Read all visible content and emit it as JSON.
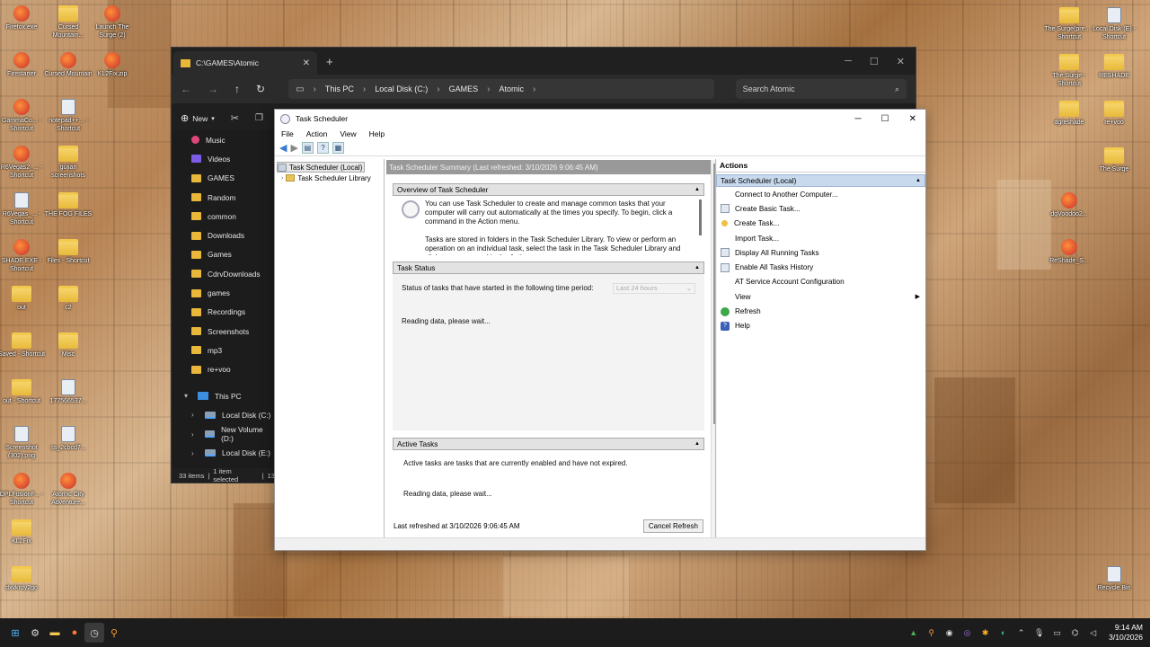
{
  "desktop": {
    "icons_left": [
      {
        "label": "Firefox.exe",
        "type": "app"
      },
      {
        "label": "Cursed Mountain...",
        "type": "folder"
      },
      {
        "label": "Launch The Surge (2)",
        "type": "app"
      },
      {
        "label": "Firestarter",
        "type": "app"
      },
      {
        "label": "Cursed Mountain",
        "type": "app"
      },
      {
        "label": "KL2Fix.zip",
        "type": "app"
      },
      {
        "label": "GammaCo... - Shortcut",
        "type": "app"
      },
      {
        "label": "notepad++... - Shortcut",
        "type": "file"
      },
      {
        "label": "R6Vegas2_... - Shortcut",
        "type": "app"
      },
      {
        "label": "gujian screenshots",
        "type": "folder"
      },
      {
        "label": "R6Vegas_... - Shortcut",
        "type": "file"
      },
      {
        "label": "THE FOG FILES",
        "type": "folder"
      },
      {
        "label": "SHADE.EXE - Shortcut",
        "type": "app"
      },
      {
        "label": "Files - Shortcut",
        "type": "folder"
      },
      {
        "label": "out",
        "type": "folder"
      },
      {
        "label": "c2",
        "type": "folder"
      },
      {
        "label": "Saved - Shortcut",
        "type": "folder"
      },
      {
        "label": "Misc",
        "type": "folder"
      },
      {
        "label": "out - Shortcut",
        "type": "folder"
      },
      {
        "label": "177566537...",
        "type": "file"
      },
      {
        "label": "Screenshot (302).png",
        "type": "file"
      },
      {
        "label": "ss_2cbcd7...",
        "type": "file"
      },
      {
        "label": "DPLFusionF... - Shortcut",
        "type": "app"
      },
      {
        "label": "Atomic City Adventure...",
        "type": "app"
      },
      {
        "label": "KL2Fix",
        "type": "folder"
      },
      {
        "label": "dxvkrdy2go",
        "type": "folder"
      }
    ],
    "icons_right": [
      {
        "label": "The Surge(pre... - Shortcut",
        "type": "folder"
      },
      {
        "label": "Local Disk (E) - Shortcut",
        "type": "file"
      },
      {
        "label": "The Surge - Shortcut",
        "type": "folder"
      },
      {
        "label": "RESHADE",
        "type": "folder"
      },
      {
        "label": "dgreshade",
        "type": "folder"
      },
      {
        "label": "re+voo",
        "type": "folder"
      },
      {
        "label": "The Surge",
        "type": "folder"
      },
      {
        "label": "dgVoodoo2...",
        "type": "app"
      },
      {
        "label": "ReShade_S...",
        "type": "app"
      },
      {
        "label": "Recycle Bin",
        "type": "file"
      }
    ]
  },
  "explorer": {
    "tab_title": "C:\\GAMES\\Atomic",
    "new_tab": "+",
    "breadcrumb": [
      "This PC",
      "Local Disk (C:)",
      "GAMES",
      "Atomic"
    ],
    "search_placeholder": "Search Atomic",
    "new_label": "New",
    "sidebar": [
      {
        "label": "Music",
        "kind": "music"
      },
      {
        "label": "Videos",
        "kind": "videos"
      },
      {
        "label": "GAMES",
        "kind": "folder"
      },
      {
        "label": "Random",
        "kind": "folder"
      },
      {
        "label": "common",
        "kind": "folder"
      },
      {
        "label": "Downloads",
        "kind": "folder"
      },
      {
        "label": "Games",
        "kind": "folder"
      },
      {
        "label": "CdrvDownloads",
        "kind": "folder"
      },
      {
        "label": "games",
        "kind": "folder"
      },
      {
        "label": "Recordings",
        "kind": "folder"
      },
      {
        "label": "Screenshots",
        "kind": "folder"
      },
      {
        "label": "mp3",
        "kind": "folder"
      },
      {
        "label": "re+voo",
        "kind": "folder"
      }
    ],
    "this_pc": "This PC",
    "drives": [
      "Local Disk (C:)",
      "New Volume (D:)",
      "Local Disk (E:)"
    ],
    "status_items": "33 items",
    "status_selected": "1 item selected",
    "status_extra": "13"
  },
  "task_scheduler": {
    "title": "Task Scheduler",
    "menu": [
      "File",
      "Action",
      "View",
      "Help"
    ],
    "tree": {
      "root": "Task Scheduler (Local)",
      "child": "Task Scheduler Library"
    },
    "summary_header": "Task Scheduler Summary (Last refreshed: 3/10/2026 9:06:45 AM)",
    "overview": {
      "title": "Overview of Task Scheduler",
      "para1": "You can use Task Scheduler to create and manage common tasks that your computer will carry out automatically at the times you specify. To begin, click a command in the Action menu.",
      "para2": "Tasks are stored in folders in the Task Scheduler Library. To view or perform an operation on an individual task, select the task in the Task Scheduler Library and click on a command in the Action menu."
    },
    "task_status": {
      "title": "Task Status",
      "period_label": "Status of tasks that have started in the following time period:",
      "period_value": "Last 24 hours",
      "reading": "Reading data, please wait..."
    },
    "active_tasks": {
      "title": "Active Tasks",
      "desc": "Active tasks are tasks that are currently enabled and have not expired.",
      "reading": "Reading data, please wait..."
    },
    "last_refreshed": "Last refreshed at 3/10/2026 9:06:45 AM",
    "cancel_refresh": "Cancel Refresh",
    "actions": {
      "header": "Actions",
      "group": "Task Scheduler (Local)",
      "items": [
        {
          "label": "Connect to Another Computer...",
          "icon": "blank"
        },
        {
          "label": "Create Basic Task...",
          "icon": "doc"
        },
        {
          "label": "Create Task...",
          "icon": "star"
        },
        {
          "label": "Import Task...",
          "icon": "blank"
        },
        {
          "label": "Display All Running Tasks",
          "icon": "doc"
        },
        {
          "label": "Enable All Tasks History",
          "icon": "doc"
        },
        {
          "label": "AT Service Account Configuration",
          "icon": "blank"
        },
        {
          "label": "View",
          "icon": "blank",
          "submenu": true
        },
        {
          "label": "Refresh",
          "icon": "green"
        },
        {
          "label": "Help",
          "icon": "blue"
        }
      ]
    }
  },
  "taskbar": {
    "time": "9:14 AM",
    "date": "3/10/2026"
  }
}
